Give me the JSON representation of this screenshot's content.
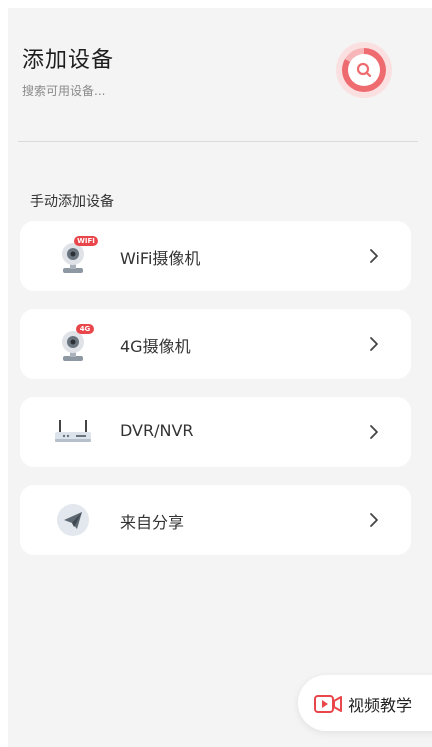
{
  "header": {
    "title": "添加设备",
    "subtitle": "搜索可用设备..."
  },
  "section": {
    "title": "手动添加设备"
  },
  "devices": [
    {
      "label": "WiFi摄像机",
      "badge": "WIFI",
      "icon": "wifi-camera-icon"
    },
    {
      "label": "4G摄像机",
      "badge": "4G",
      "icon": "4g-camera-icon"
    },
    {
      "label": "DVR/NVR",
      "icon": "recorder-icon"
    },
    {
      "label": "来自分享",
      "icon": "paper-plane-icon"
    }
  ],
  "tutorial": {
    "label": "视频教学",
    "icon": "video-icon"
  },
  "colors": {
    "accent": "#ee6b6f",
    "badge": "#e9464b",
    "background": "#f4f4f4",
    "card": "#ffffff"
  }
}
